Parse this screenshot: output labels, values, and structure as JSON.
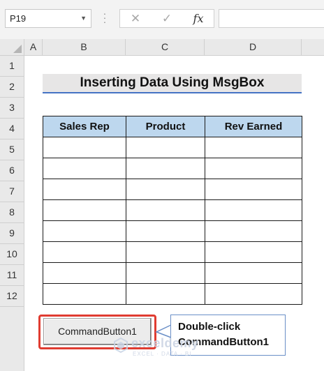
{
  "formula_bar": {
    "name_box": "P19",
    "cancel_icon": "x-icon",
    "enter_icon": "check-icon",
    "fx_label": "fx",
    "formula_value": ""
  },
  "columns": [
    "A",
    "B",
    "C",
    "D"
  ],
  "rows": [
    "1",
    "2",
    "3",
    "4",
    "5",
    "6",
    "7",
    "8",
    "9",
    "10",
    "11",
    "12"
  ],
  "title": "Inserting Data Using MsgBox",
  "table": {
    "headers": [
      "Sales Rep",
      "Product",
      "Rev Earned"
    ],
    "rows": [
      [
        "",
        "",
        ""
      ],
      [
        "",
        "",
        ""
      ],
      [
        "",
        "",
        ""
      ],
      [
        "",
        "",
        ""
      ],
      [
        "",
        "",
        ""
      ],
      [
        "",
        "",
        ""
      ],
      [
        "",
        "",
        ""
      ],
      [
        "",
        "",
        ""
      ]
    ]
  },
  "command_button": {
    "label": "CommandButton1"
  },
  "callout": {
    "line1": "Double-click",
    "line2": "CommandButton1"
  },
  "watermark": {
    "name": "exceldemy",
    "tagline": "EXCEL · DATA · BI"
  },
  "colors": {
    "header_fill": "#bdd7ee",
    "title_fill": "#e7e6e6",
    "title_underline": "#4472c4",
    "highlight": "#e03c31",
    "callout_border": "#6a8fc7"
  }
}
